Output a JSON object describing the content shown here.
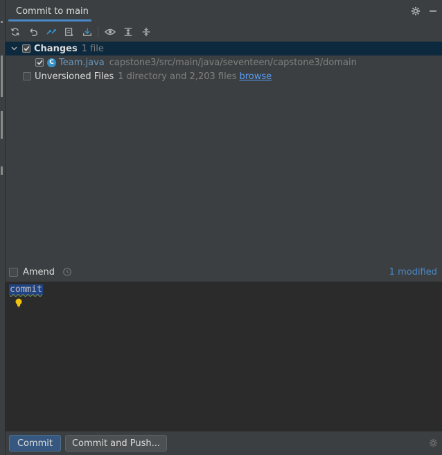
{
  "header": {
    "tab_label": "Commit to main",
    "icons": [
      "gear-icon",
      "minimize-icon"
    ]
  },
  "toolbar": {
    "buttons": [
      "refresh-icon",
      "rollback-icon",
      "show-diff-icon",
      "changelist-icon",
      "update-icon",
      "view-options-icon",
      "expand-all-icon",
      "collapse-all-icon"
    ]
  },
  "changes": {
    "group_label": "Changes",
    "group_count": "1 file",
    "file_name": "Team.java",
    "file_path": "capstone3/src/main/java/seventeen/capstone3/domain",
    "file_icon_letter": "C"
  },
  "unversioned": {
    "label": "Unversioned Files",
    "summary": "1 directory and 2,203 files",
    "link": "browse"
  },
  "amend": {
    "label": "Amend",
    "modified": "1 modified"
  },
  "editor": {
    "message": "commit"
  },
  "buttons": {
    "commit": "Commit",
    "commit_push": "Commit and Push..."
  },
  "colors": {
    "accent": "#4a88c7",
    "selection": "#0d293e",
    "primary_button": "#365880"
  }
}
